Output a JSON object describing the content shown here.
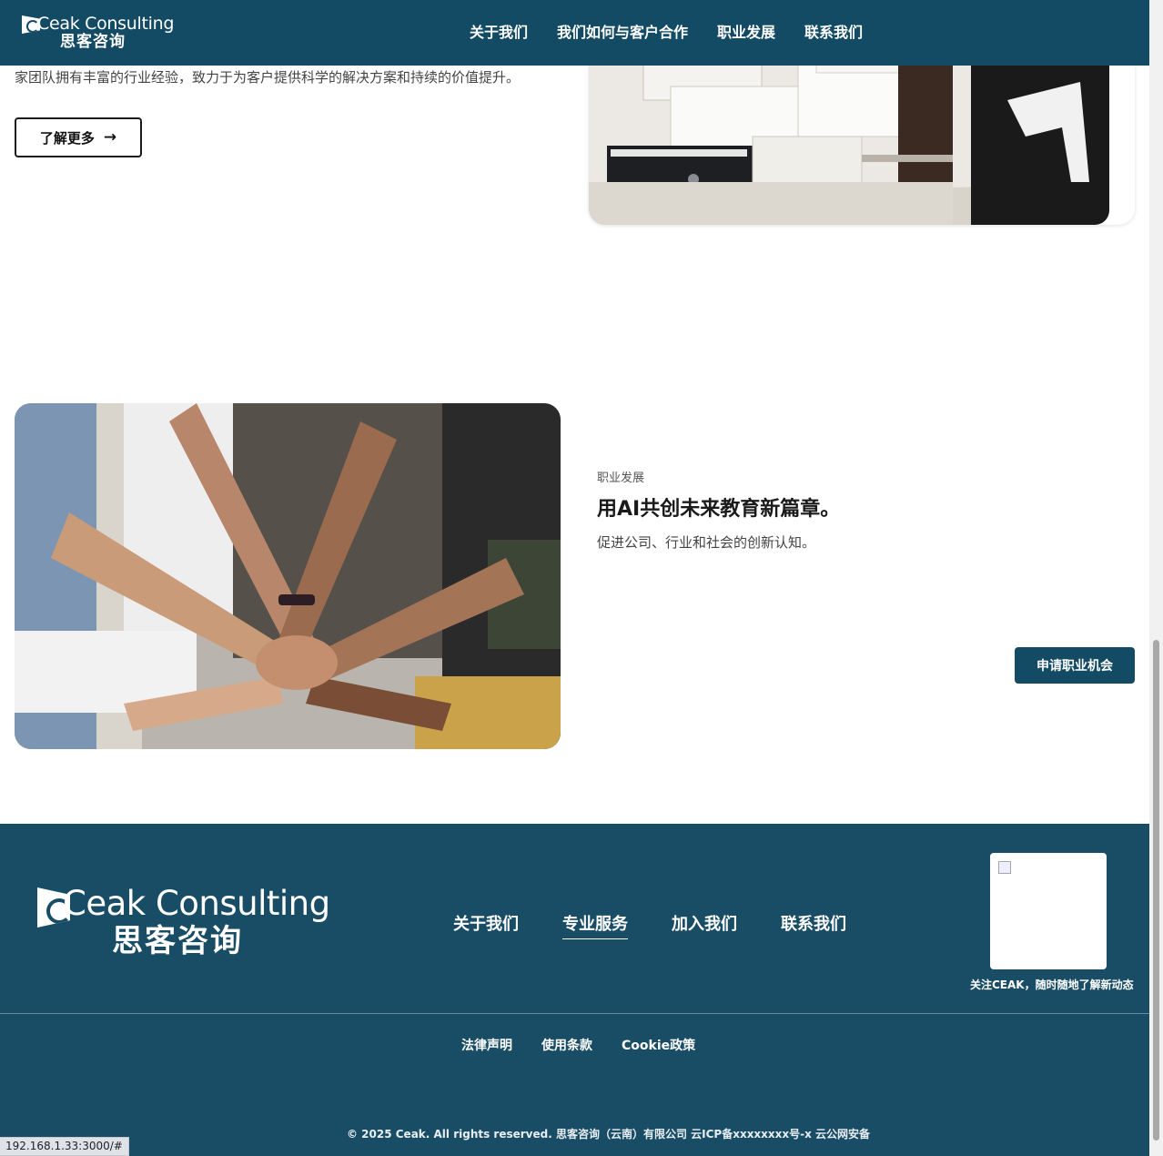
{
  "header": {
    "logo": {
      "en": "Ceak Consulting",
      "cn": "思客咨询"
    },
    "nav": [
      "关于我们",
      "我们如何与客户合作",
      "职业发展",
      "联系我们"
    ]
  },
  "intro": {
    "text": "家团队拥有丰富的行业经验，致力于为客户提供科学的解决方案和持续的价值提升。",
    "more_label": "了解更多",
    "more_arrow": "→"
  },
  "career": {
    "eyebrow": "职业发展",
    "title": "用AI共创未来教育新篇章。",
    "subtitle": "促进公司、行业和社会的创新认知。",
    "apply_label": "申请职业机会"
  },
  "footer": {
    "logo": {
      "en": "Ceak Consulting",
      "cn": "思客咨询"
    },
    "nav": [
      "关于我们",
      "专业服务",
      "加入我们",
      "联系我们"
    ],
    "active_nav": "专业服务",
    "qr_caption": "关注CEAK，随时随地了解新动态",
    "links": [
      "法律声明",
      "使用条款",
      "Cookie政策"
    ],
    "copyright": "© 2025 Ceak. All rights reserved. 思客咨询（云南）有限公司 云ICP备xxxxxxxx号-x 云公网安备"
  },
  "status_bar": {
    "url": "192.168.1.33:3000/#"
  },
  "colors": {
    "brand": "#134a64",
    "footer": "#194d66"
  }
}
